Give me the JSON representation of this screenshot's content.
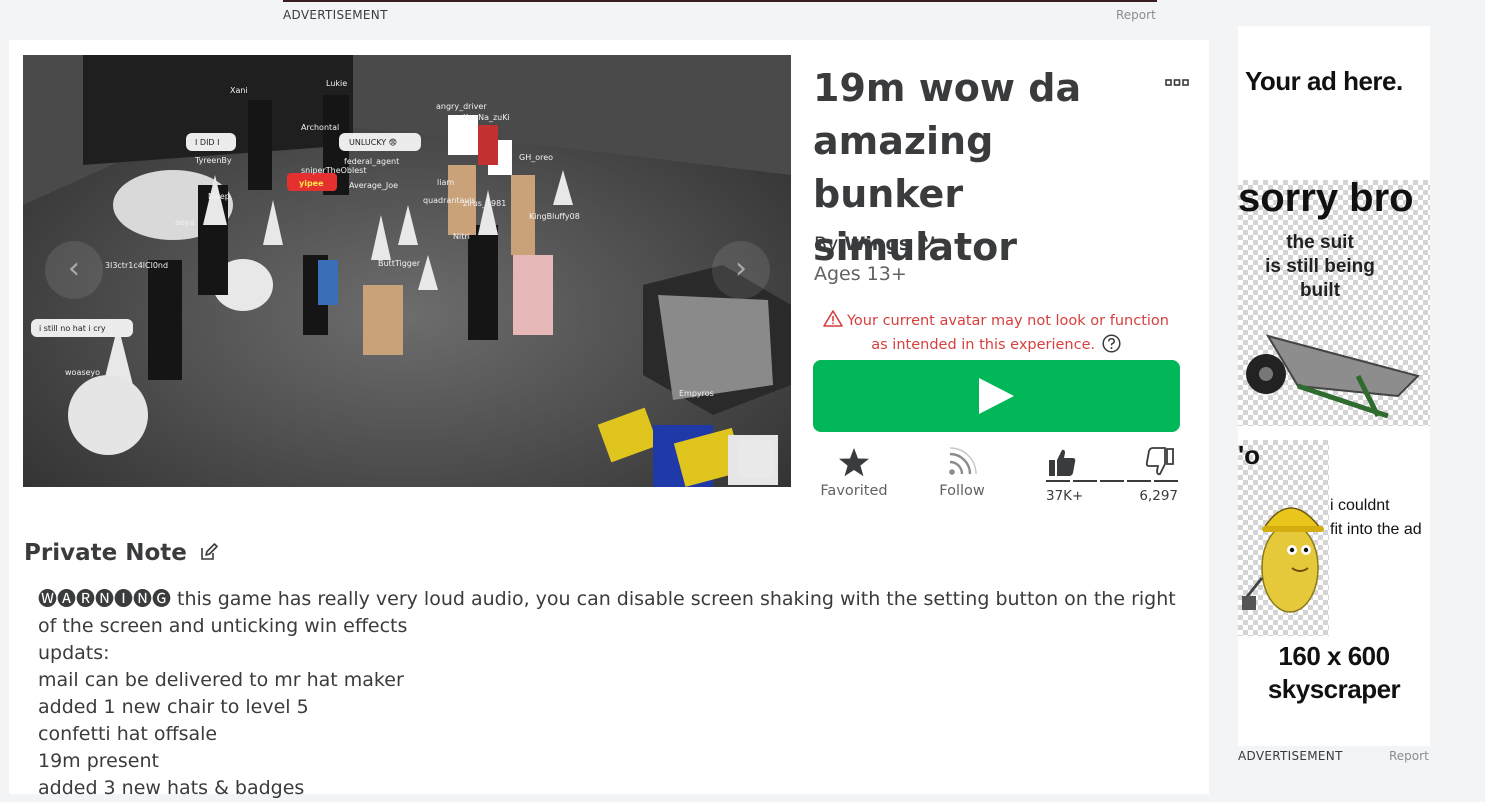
{
  "top_ad": {
    "label": "ADVERTISEMENT",
    "report": "Report"
  },
  "game": {
    "title": "19m wow da amazing bunker simulator",
    "creator_prefix": "By",
    "creator_name": "Wings ツ",
    "ages": "Ages 13+",
    "warning_text": "Your current avatar may not look or function as intended in this experience.",
    "play_icon": "play-icon"
  },
  "media": {
    "name_tags": [
      "Xani",
      "Lukie",
      "angry_driver",
      "KanNa_zuKi",
      "Archontal",
      "I DID I",
      "UNLUCKY 😨",
      "TyreenBy",
      "federal_agent",
      "sniperTheOblest",
      "GH_oreo",
      "yipee",
      "Average_Joe",
      "liam",
      "Meep",
      "quadrantavis",
      "zirus_1981",
      "aoya",
      "KingBluffy08",
      "Nitri",
      "3l3ctr1c4lCl0nd",
      "ButtTigger",
      "i still no hat i cry",
      "woaseyo",
      "Empyros"
    ]
  },
  "actions": {
    "favorite": {
      "label": "Favorited",
      "icon": "star-icon"
    },
    "follow": {
      "label": "Follow",
      "icon": "rss-icon"
    },
    "upvotes": "37K+",
    "downvotes": "6,297",
    "upvote_fraction": 0.86
  },
  "private_note": {
    "heading": "Private Note",
    "description": "🅦🅐🅡🅝🅘🅝🅖 this game has really very loud audio, you can disable screen shaking with the setting button on the right of the screen and unticking win effects\nupdats:\nmail can be delivered to mr hat maker\nadded 1 new chair to level 5\nconfetti hat offsale\n19m present\nadded 3 new hats & badges"
  },
  "side_ad": {
    "headline": "Your ad here.",
    "sorry": "sorry bro",
    "suit_text": "the suit\nis still being\nbuilt",
    "partial_letter": "'o",
    "couldnt_text": "i couldnt\nfit into the ad",
    "size_text": "160 x 600\nskyscraper",
    "label": "ADVERTISEMENT",
    "report": "Report"
  },
  "colors": {
    "play_green": "#02b757",
    "warning_red": "#d63f3d",
    "text_dark": "#393b3d",
    "page_bg": "#f2f4f5"
  }
}
